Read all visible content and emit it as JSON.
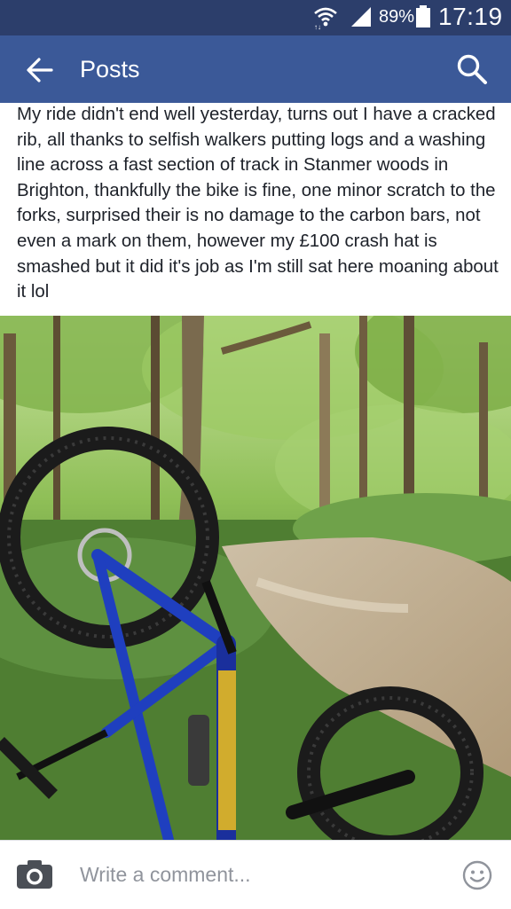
{
  "status_bar": {
    "battery_percent": "89%",
    "time": "17:19",
    "icons": [
      "wifi-icon",
      "signal-icon",
      "battery-icon"
    ]
  },
  "header": {
    "title": "Posts",
    "back_icon": "back-arrow-icon",
    "search_icon": "search-icon",
    "background_color": "#3b5998"
  },
  "post": {
    "text": "My ride didn't end well yesterday,  turns out I have a cracked rib, all thanks to selfish walkers putting logs and a washing line across a fast section of track in Stanmer woods in Brighton, thankfully the bike is fine, one minor scratch to the forks, surprised their is no damage to the carbon bars, not even a mark on them, however my £100 crash hat is smashed but it did it's job as I'm still sat here moaning about it lol",
    "photo": "photo of an upside-down blue mountain bike with fat tyres lying in the woods beside a dirt trail"
  },
  "comment_bar": {
    "placeholder": "Write a comment...",
    "camera_icon": "camera-icon",
    "emoji_icon": "smiley-icon"
  }
}
